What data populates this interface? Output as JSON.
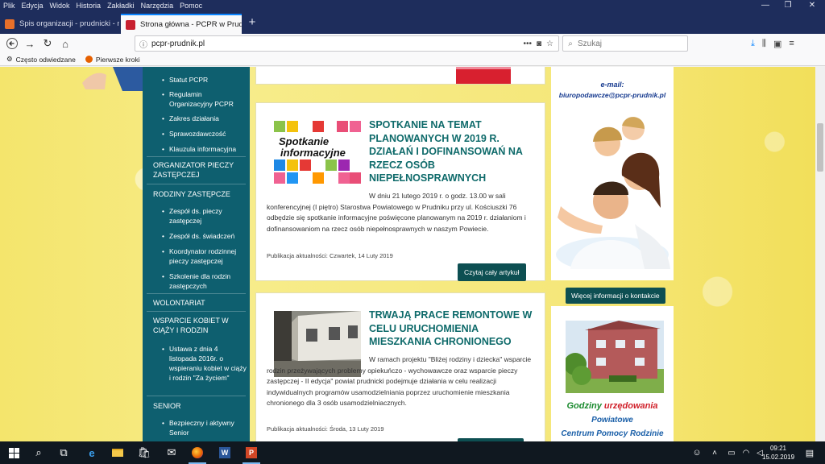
{
  "menubar": {
    "items": [
      "Plik",
      "Edycja",
      "Widok",
      "Historia",
      "Zakładki",
      "Narzędzia",
      "Pomoc"
    ],
    "window_controls": [
      "—",
      "❐",
      "✕"
    ]
  },
  "tabs": [
    {
      "title": "Spis organizacji - prudnicki - n",
      "active": false
    },
    {
      "title": "Strona główna - PCPR w Prudni",
      "active": true
    }
  ],
  "navbar": {
    "url": "pcpr-prudnik.pl",
    "search_placeholder": "Szukaj"
  },
  "bookmarks": [
    {
      "label": "Często odwiedzane"
    },
    {
      "label": "Pierwsze kroki"
    }
  ],
  "sidebar": {
    "group1": [
      "Statut PCPR",
      "Regulamin Organizacyjny PCPR",
      "Zakres działania",
      "Sprawozdawczość",
      "Klauzula informacyjna"
    ],
    "head_organizator": "ORGANIZATOR PIECZY ZASTĘPCZEJ",
    "head_rodziny": "RODZINY ZASTĘPCZE",
    "group2": [
      "Zespół ds. pieczy zastępczej",
      "Zespół ds. świadczeń",
      "Koordynator rodzinnej pieczy zastępczej",
      "Szkolenie dla rodzin zastępczych"
    ],
    "head_wolontariat": "WOLONTARIAT",
    "head_wsparcie": "WSPARCIE KOBIET W CIĄŻY I RODZIN",
    "group3": [
      "Ustawa z dnia 4 listopada 2016r. o wspieraniu kobiet w ciąży i rodzin \"Za życiem\""
    ],
    "head_senior": "SENIOR",
    "group4": [
      "Bezpieczny i aktywny Senior"
    ]
  },
  "articles": [
    {
      "logo_text": [
        "Spotkanie",
        "informacyjne"
      ],
      "title": "SPOTKANIE NA TEMAT PLANOWANYCH W 2019 R. DZIAŁAŃ I DOFINANSOWAŃ NA RZECZ OSÓB NIEPEŁNOSPRAWNYCH",
      "body": "W dniu 21 lutego 2019 r. o godz. 13.00 w sali konferencyjnej (I piętro) Starostwa Powiatowego w Prudniku przy ul. Kościuszki 76 odbędzie się spotkanie informacyjne poświęcone planowanym na 2019 r. działaniom i dofinansowaniom na rzecz osób niepełnosprawnych w naszym Powiecie.",
      "meta": "Publikacja aktualności: Czwartek, 14 Luty 2019",
      "button": "Czytaj cały artykuł"
    },
    {
      "title": "TRWAJĄ PRACE REMONTOWE W CELU URUCHOMIENIA MIESZKANIA CHRONIONEGO",
      "body": "W ramach projektu \"Bliżej rodziny i dziecka\" wsparcie rodzin przeżywających problemy opiekuńczo - wychowawcze oraz wsparcie pieczy zastępczej - II edycja\" powiat prudnicki podejmuje działania w celu realizacji indywidualnych programów usamodzielniania poprzez uruchomienie mieszkania chronionego dla 3 osób usamodzielniacznych.",
      "meta": "Publikacja aktualności: Środa, 13 Luty 2019"
    }
  ],
  "contact": {
    "email_label": "e-mail:",
    "email": "biuropodawcze@pcpr-prudnik.pl",
    "button": "Więcej informacji o kontakcie"
  },
  "hours": {
    "line1a": "Godziny ",
    "line1b": "urzędowania",
    "line2": "Powiatowe",
    "line3": "Centrum Pomocy Rodzinie"
  },
  "taskbar": {
    "time": "09:21",
    "date": "15.02.2019"
  },
  "colors": {
    "sidebar": "#0e5f6f",
    "title_teal": "#0e6a6a",
    "button_dark": "#0d4f52",
    "hours_red": "#d0202a",
    "hours_green": "#1a8a2e"
  }
}
